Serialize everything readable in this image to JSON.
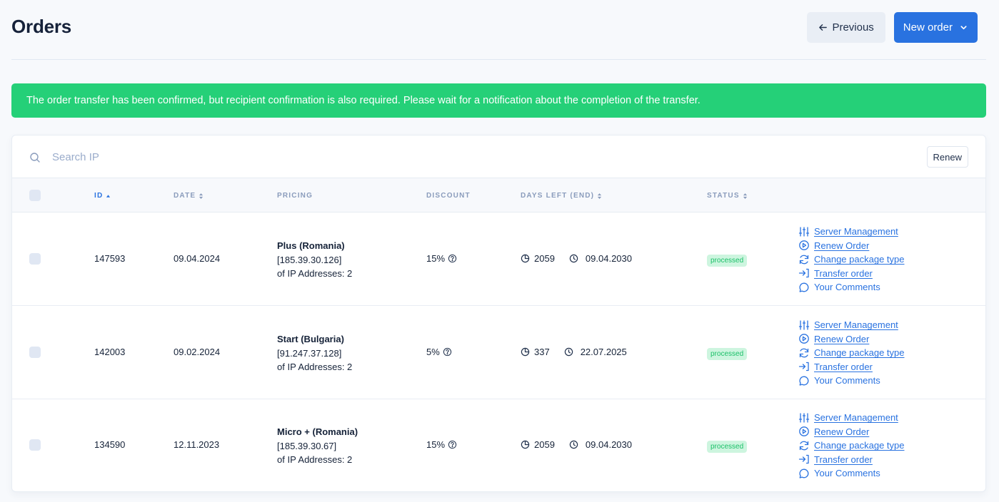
{
  "header": {
    "title": "Orders",
    "previous_label": "Previous",
    "new_order_label": "New order"
  },
  "alert": {
    "message": "The order transfer has been confirmed, but recipient confirmation is also required. Please wait for a notification about the completion of the transfer.",
    "color": "#25d078"
  },
  "search": {
    "placeholder": "Search IP",
    "value": "",
    "renew_label": "Renew"
  },
  "table": {
    "columns": {
      "id": "ID",
      "date": "DATE",
      "pricing": "PRICING",
      "discount": "DISCOUNT",
      "days_left": "DAYS LEFT (END)",
      "status": "STATUS"
    },
    "sort": {
      "column": "id",
      "direction": "asc"
    },
    "action_labels": {
      "server_management": "Server Management",
      "renew_order": "Renew Order",
      "change_package": "Change package type",
      "transfer_order": "Transfer order",
      "comments": "Your Comments"
    },
    "rows": [
      {
        "id": "147593",
        "date": "09.04.2024",
        "plan": "Plus (Romania)",
        "ip": "[185.39.30.126]",
        "ip_count": "of IP Addresses: 2",
        "discount": "15%",
        "days_left": "2059",
        "end_date": "09.04.2030",
        "status": "processed"
      },
      {
        "id": "142003",
        "date": "09.02.2024",
        "plan": "Start (Bulgaria)",
        "ip": "[91.247.37.128]",
        "ip_count": "of IP Addresses: 2",
        "discount": "5%",
        "days_left": "337",
        "end_date": "22.07.2025",
        "status": "processed"
      },
      {
        "id": "134590",
        "date": "12.11.2023",
        "plan": "Micro + (Romania)",
        "ip": "[185.39.30.67]",
        "ip_count": "of IP Addresses: 2",
        "discount": "15%",
        "days_left": "2059",
        "end_date": "09.04.2030",
        "status": "processed"
      }
    ]
  },
  "colors": {
    "accent": "#2972e0",
    "status_bg": "#cdf5df",
    "status_text": "#1cc069"
  }
}
